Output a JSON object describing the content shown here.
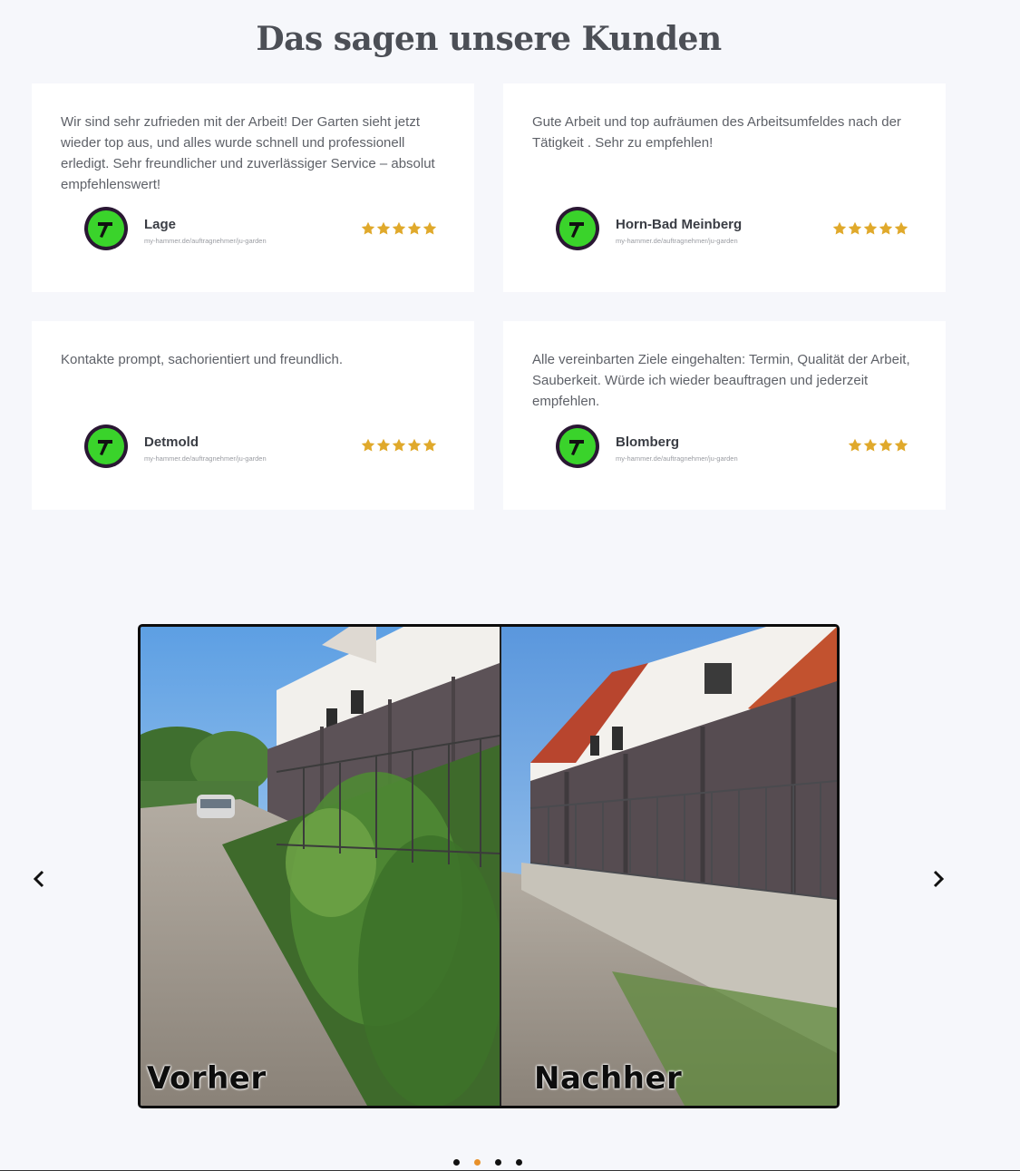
{
  "section_title": "Das sagen unsere Kunden",
  "reviews": [
    {
      "text": "Wir sind sehr zufrieden mit der Arbeit! Der Garten sieht jetzt wieder top aus, und alles wurde schnell und professionell erledigt. Sehr freundlicher und zuverlässiger Service – absolut empfehlenswert!",
      "name": "Lage",
      "source": "my-hammer.de/auftragnehmer/ju-garden",
      "rating": 5
    },
    {
      "text": "Gute Arbeit und top aufräumen des Arbeitsumfeldes nach der Tätigkeit . Sehr zu empfehlen!",
      "name": "Horn-Bad Meinberg",
      "source": "my-hammer.de/auftragnehmer/ju-garden",
      "rating": 5
    },
    {
      "text": "Kontakte prompt, sachorientiert und freundlich.",
      "name": "Detmold",
      "source": "my-hammer.de/auftragnehmer/ju-garden",
      "rating": 5
    },
    {
      "text": "Alle vereinbarten Ziele eingehalten: Termin, Qualität der Arbeit, Sauberkeit. Würde ich wieder beauftragen und jederzeit empfehlen.",
      "name": "Blomberg",
      "source": "my-hammer.de/auftragnehmer/ju-garden",
      "rating": 4
    }
  ],
  "slider": {
    "before_label": "Vorher",
    "after_label": "Nachher",
    "total_slides": 4,
    "active_slide": 2
  },
  "icons": {
    "avatar": "hammer-icon",
    "rating": "star-icon",
    "prev": "chevron-left-icon",
    "next": "chevron-right-icon"
  },
  "colors": {
    "background": "#f6f7fb",
    "card": "#ffffff",
    "star": "#e0a92b",
    "avatar_green": "#3ad32b",
    "active_dot": "#e8912a"
  }
}
